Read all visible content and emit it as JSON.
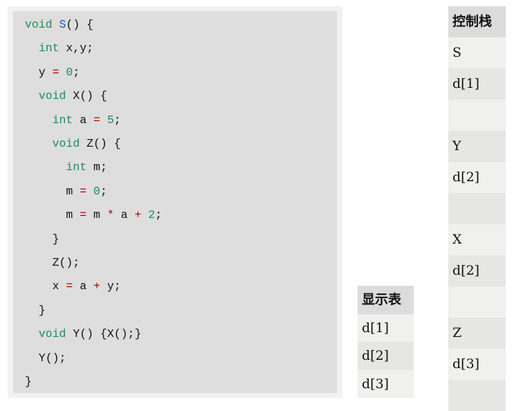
{
  "code": {
    "lines": [
      [
        {
          "t": "void",
          "c": "kw"
        },
        {
          "t": " ",
          "c": "id"
        },
        {
          "t": "S",
          "c": "fn"
        },
        {
          "t": "() {",
          "c": "id"
        }
      ],
      [
        {
          "t": "  ",
          "c": "id"
        },
        {
          "t": "int",
          "c": "kw"
        },
        {
          "t": " x,y;",
          "c": "id"
        }
      ],
      [
        {
          "t": "  y ",
          "c": "id"
        },
        {
          "t": "=",
          "c": "op"
        },
        {
          "t": " ",
          "c": "id"
        },
        {
          "t": "0",
          "c": "num"
        },
        {
          "t": ";",
          "c": "id"
        }
      ],
      [
        {
          "t": "  ",
          "c": "id"
        },
        {
          "t": "void",
          "c": "kw"
        },
        {
          "t": " X() {",
          "c": "id"
        }
      ],
      [
        {
          "t": "    ",
          "c": "id"
        },
        {
          "t": "int",
          "c": "kw"
        },
        {
          "t": " a ",
          "c": "id"
        },
        {
          "t": "=",
          "c": "op"
        },
        {
          "t": " ",
          "c": "id"
        },
        {
          "t": "5",
          "c": "num"
        },
        {
          "t": ";",
          "c": "id"
        }
      ],
      [
        {
          "t": "    ",
          "c": "id"
        },
        {
          "t": "void",
          "c": "kw"
        },
        {
          "t": " Z() {",
          "c": "id"
        }
      ],
      [
        {
          "t": "      ",
          "c": "id"
        },
        {
          "t": "int",
          "c": "kw"
        },
        {
          "t": " m;",
          "c": "id"
        }
      ],
      [
        {
          "t": "      m ",
          "c": "id"
        },
        {
          "t": "=",
          "c": "op"
        },
        {
          "t": " ",
          "c": "id"
        },
        {
          "t": "0",
          "c": "num"
        },
        {
          "t": ";",
          "c": "id"
        }
      ],
      [
        {
          "t": "      m ",
          "c": "id"
        },
        {
          "t": "=",
          "c": "op"
        },
        {
          "t": " m ",
          "c": "id"
        },
        {
          "t": "*",
          "c": "op"
        },
        {
          "t": " a ",
          "c": "id"
        },
        {
          "t": "+",
          "c": "op"
        },
        {
          "t": " ",
          "c": "id"
        },
        {
          "t": "2",
          "c": "num"
        },
        {
          "t": ";",
          "c": "id"
        }
      ],
      [
        {
          "t": "    }",
          "c": "id"
        }
      ],
      [
        {
          "t": "    Z();",
          "c": "id"
        }
      ],
      [
        {
          "t": "    x ",
          "c": "id"
        },
        {
          "t": "=",
          "c": "op"
        },
        {
          "t": " a ",
          "c": "id"
        },
        {
          "t": "+",
          "c": "op"
        },
        {
          "t": " y;",
          "c": "id"
        }
      ],
      [
        {
          "t": "  }",
          "c": "id"
        }
      ],
      [
        {
          "t": "  ",
          "c": "id"
        },
        {
          "t": "void",
          "c": "kw"
        },
        {
          "t": " Y() {X();}",
          "c": "id"
        }
      ],
      [
        {
          "t": "  Y();",
          "c": "id"
        }
      ],
      [
        {
          "t": "}",
          "c": "id"
        }
      ]
    ]
  },
  "display_table": {
    "header": "显示表",
    "rows": [
      "d[1]",
      "d[2]",
      "d[3]"
    ]
  },
  "control_stack": {
    "header": "控制栈",
    "rows": [
      "S",
      "d[1]",
      "",
      "Y",
      "d[2]",
      "",
      "X",
      "d[2]",
      "",
      "Z",
      "d[3]",
      ""
    ]
  },
  "colors": {
    "keyword": "#1f8a5f",
    "function_name": "#1f4fd6",
    "operator": "#b00000",
    "number": "#1f8a5f",
    "code_background": "#dedede",
    "cell_light": "#f0f0ee",
    "cell_dark": "#e6e6e4",
    "header_background": "#dcdcdc"
  }
}
